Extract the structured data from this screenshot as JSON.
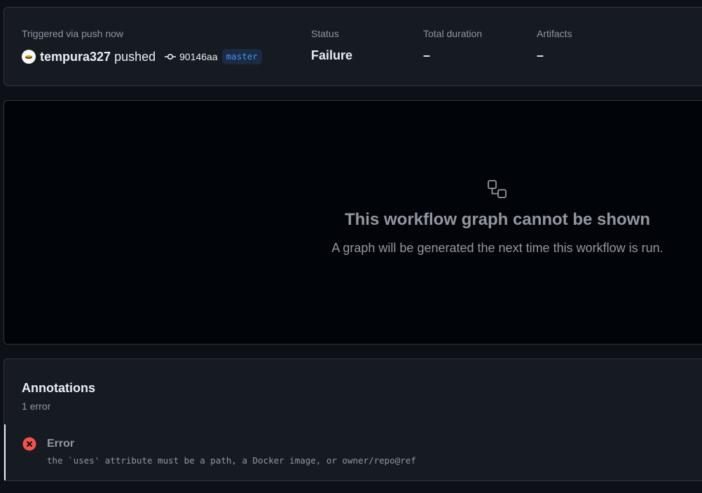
{
  "summary": {
    "trigger_label": "Triggered via push now",
    "actor": "tempura327",
    "action": "pushed",
    "commit_sha": "90146aa",
    "branch": "master",
    "status_label": "Status",
    "status_value": "Failure",
    "duration_label": "Total duration",
    "duration_value": "–",
    "artifacts_label": "Artifacts",
    "artifacts_value": "–"
  },
  "graph": {
    "title": "This workflow graph cannot be shown",
    "subtitle": "A graph will be generated the next time this workflow is run.",
    "icon": "workflow-icon"
  },
  "annotations": {
    "title": "Annotations",
    "count": "1 error",
    "items": [
      {
        "level": "Error",
        "icon": "x-circle-icon",
        "message": "the `uses' attribute must be a path, a Docker image, or owner/repo@ref"
      }
    ]
  },
  "colors": {
    "background": "#0d1117",
    "card": "#161b22",
    "border": "#30363d",
    "muted_text": "#9198a1",
    "error": "#f85149",
    "branch_accent": "#4493f8"
  }
}
